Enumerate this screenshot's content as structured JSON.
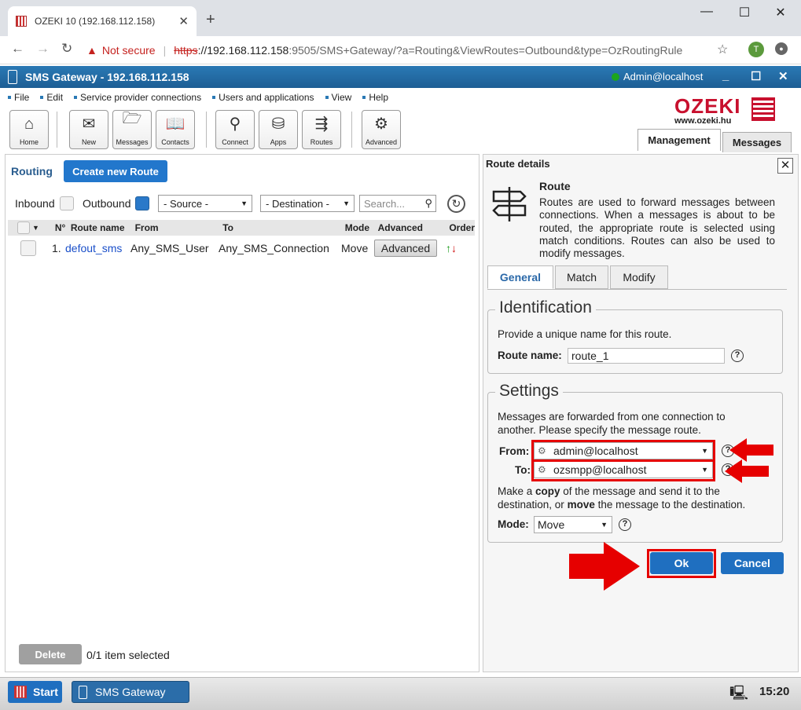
{
  "browser": {
    "tab_title": "OZEKI 10 (192.168.112.158)",
    "new_tab": "+",
    "tab_close": "✕",
    "window_min": "—",
    "window_max": "☐",
    "window_close": "✕",
    "security_warning": "Not secure",
    "url_scheme": "https",
    "url_sep": "://",
    "url_host": "192.168.112.158",
    "url_rest": ":9505/SMS+Gateway/?a=Routing&ViewRoutes=Outbound&type=OzRoutingRule",
    "profile_initial": "T"
  },
  "app": {
    "title": "SMS Gateway - 192.168.112.158",
    "user": "Admin@localhost",
    "menu": [
      "File",
      "Edit",
      "Service provider connections",
      "Users and applications",
      "View",
      "Help"
    ],
    "toolbar": [
      {
        "label": "Home",
        "icon": "home-icon"
      },
      {
        "label": "New",
        "icon": "new-message-icon"
      },
      {
        "label": "Messages",
        "icon": "folder-icon"
      },
      {
        "label": "Contacts",
        "icon": "contacts-book-icon"
      },
      {
        "label": "Connect",
        "icon": "antenna-icon"
      },
      {
        "label": "Apps",
        "icon": "database-icon"
      },
      {
        "label": "Routes",
        "icon": "signpost-icon"
      },
      {
        "label": "Advanced",
        "icon": "gear-icon"
      }
    ],
    "logo_text": "OZEKI",
    "logo_url": "www.ozeki.hu",
    "view_tabs": [
      "Management",
      "Messages"
    ]
  },
  "routing": {
    "label": "Routing",
    "create_button": "Create new Route",
    "inbound_label": "Inbound",
    "outbound_label": "Outbound",
    "source_select": "- Source -",
    "destination_select": "- Destination -",
    "search_placeholder": "Search...",
    "columns": [
      "N°",
      "Route name",
      "From",
      "To",
      "Mode",
      "Advanced",
      "Order"
    ],
    "rows": [
      {
        "n": "1.",
        "name": "defout_sms",
        "from": "Any_SMS_User",
        "to": "Any_SMS_Connection",
        "mode": "Move",
        "advanced": "Advanced"
      }
    ],
    "delete_button": "Delete",
    "selection_count": "0/1 item selected"
  },
  "route_details": {
    "panel_title": "Route details",
    "heading": "Route",
    "description": "Routes are used to forward messages between connections. When a messages is about to be routed, the appropriate route is selected using match conditions. Routes can also be used to modify messages.",
    "tabs": [
      "General",
      "Match",
      "Modify"
    ],
    "identification": {
      "legend": "Identification",
      "hint": "Provide a unique name for this route.",
      "route_name_label": "Route name:",
      "route_name_value": "route_1"
    },
    "settings": {
      "legend": "Settings",
      "hint": "Messages are forwarded from one connection to another. Please specify the message route.",
      "from_label": "From:",
      "from_value": "admin@localhost",
      "to_label": "To:",
      "to_value": "ozsmpp@localhost",
      "mode_hint_1": "Make a ",
      "mode_hint_copy": "copy",
      "mode_hint_2": " of the message and send it to the destination, or ",
      "mode_hint_move": "move",
      "mode_hint_3": " the message to the destination.",
      "mode_label": "Mode:",
      "mode_value": "Move"
    },
    "ok_button": "Ok",
    "cancel_button": "Cancel"
  },
  "taskbar": {
    "start": "Start",
    "app": "SMS Gateway",
    "clock": "15:20"
  },
  "colors": {
    "accent": "#1f6fc0",
    "highlight_red": "#e60000",
    "brand_red": "#c8102e"
  }
}
